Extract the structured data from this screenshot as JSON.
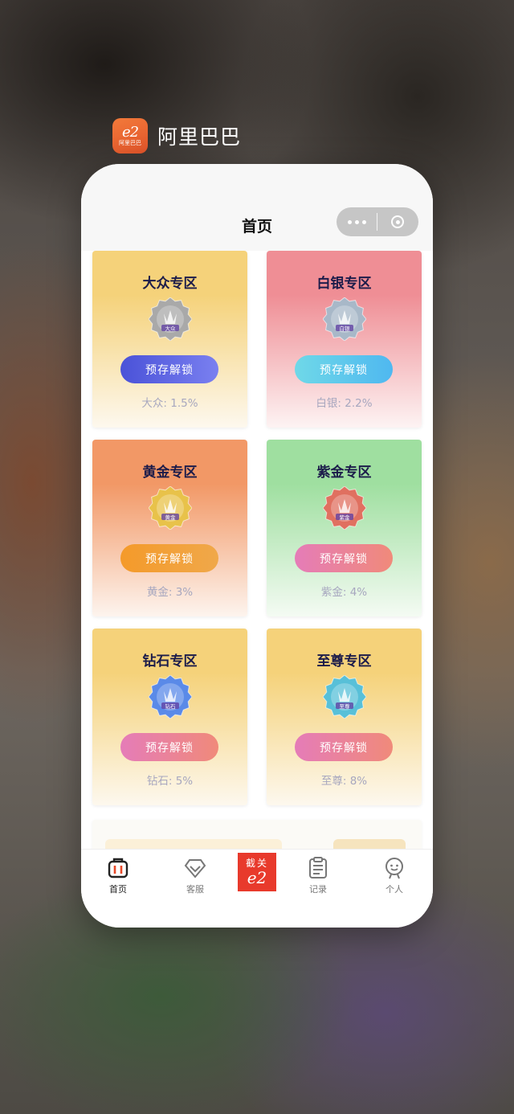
{
  "app": {
    "name": "阿里巴巴",
    "logo_text": "阿里巴巴",
    "logo_mark": "e2"
  },
  "nav": {
    "title": "首页"
  },
  "cards": [
    {
      "title": "大众专区",
      "badge_text": "大众",
      "button": "预存解锁",
      "rate": "大众:  1.5%",
      "bg_top": "#f5d27a",
      "bg_bottom": "#fdf8ee",
      "btn_from": "#4a52d8",
      "btn_to": "#7a80f0",
      "badge_color": "#a9a9a9"
    },
    {
      "title": "白银专区",
      "badge_text": "白银",
      "button": "预存解锁",
      "rate": "白银:  2.2%",
      "bg_top": "#ef8e95",
      "bg_bottom": "#fdf3f3",
      "btn_from": "#6fd8e8",
      "btn_to": "#4fb8f0",
      "badge_color": "#a8b8c8"
    },
    {
      "title": "黄金专区",
      "badge_text": "黄金",
      "button": "预存解锁",
      "rate": "黄金:  3%",
      "bg_top": "#f29866",
      "bg_bottom": "#fdf4ee",
      "btn_from": "#f49a2a",
      "btn_to": "#f0a84a",
      "badge_color": "#e8c24a"
    },
    {
      "title": "紫金专区",
      "badge_text": "紫金",
      "button": "预存解锁",
      "rate": "紫金:  4%",
      "bg_top": "#9fdfa0",
      "bg_bottom": "#f4fbf3",
      "btn_from": "#e57cb8",
      "btn_to": "#f08a7a",
      "badge_color": "#e07060"
    },
    {
      "title": "钻石专区",
      "badge_text": "钻石",
      "button": "预存解锁",
      "rate": "钻石:  5%",
      "bg_top": "#f5d27a",
      "bg_bottom": "#fdf8ee",
      "btn_from": "#e57cb8",
      "btn_to": "#f08a7a",
      "badge_color": "#5a8ae8"
    },
    {
      "title": "至尊专区",
      "badge_text": "至尊",
      "button": "预存解锁",
      "rate": "至尊:  8%",
      "bg_top": "#f5d27a",
      "bg_bottom": "#fdf8ee",
      "btn_from": "#e57cb8",
      "btn_to": "#f08a7a",
      "badge_color": "#58c0d8"
    }
  ],
  "tabbar": {
    "items": [
      {
        "label": "首页",
        "icon": "home-bag-icon"
      },
      {
        "label": "客服",
        "icon": "diamond-service-icon"
      },
      {
        "label": "记录",
        "icon": "record-clipboard-icon"
      },
      {
        "label": "个人",
        "icon": "person-icon"
      }
    ],
    "center": {
      "text": "截关",
      "mark": "e2"
    }
  }
}
